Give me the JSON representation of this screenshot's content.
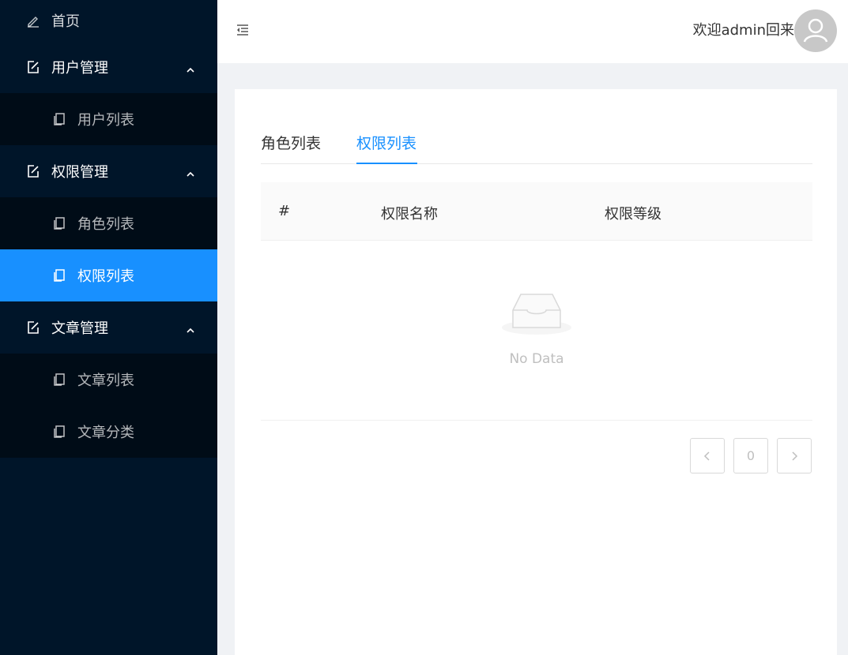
{
  "sidebar": {
    "home": {
      "label": "首页",
      "icon": "pencil-icon"
    },
    "groups": [
      {
        "label": "用户管理",
        "icon": "edit-icon",
        "expanded": true,
        "items": [
          {
            "label": "用户列表",
            "icon": "copy-icon"
          }
        ]
      },
      {
        "label": "权限管理",
        "icon": "edit-icon",
        "expanded": true,
        "items": [
          {
            "label": "角色列表",
            "icon": "copy-icon"
          },
          {
            "label": "权限列表",
            "icon": "copy-icon",
            "active": true
          }
        ]
      },
      {
        "label": "文章管理",
        "icon": "edit-icon",
        "expanded": true,
        "items": [
          {
            "label": "文章列表",
            "icon": "copy-icon"
          },
          {
            "label": "文章分类",
            "icon": "copy-icon"
          }
        ]
      }
    ]
  },
  "header": {
    "welcome": "欢迎admin回来"
  },
  "tabs": [
    {
      "label": "角色列表",
      "active": false
    },
    {
      "label": "权限列表",
      "active": true
    }
  ],
  "table": {
    "columns": [
      "#",
      "权限名称",
      "权限等级"
    ],
    "rows": [],
    "empty_text": "No Data"
  },
  "pagination": {
    "current": "0"
  },
  "colors": {
    "sidebar_bg": "#001529",
    "submenu_bg": "#000c17",
    "accent": "#1890ff"
  }
}
